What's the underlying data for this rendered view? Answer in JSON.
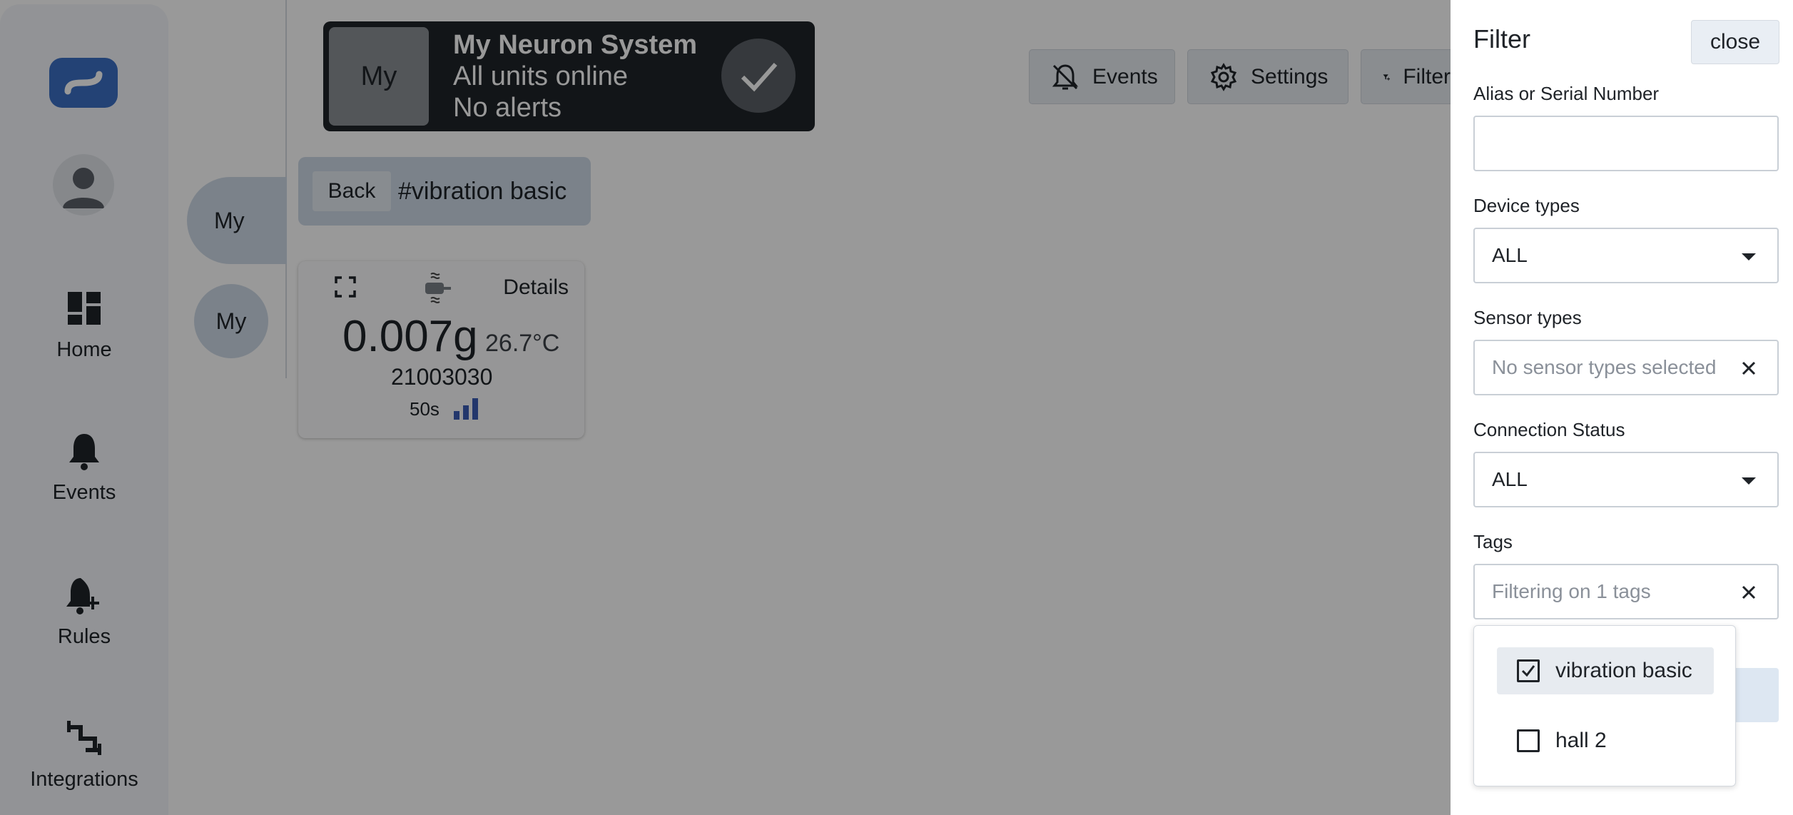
{
  "sidebar": {
    "items": [
      {
        "label": "Home",
        "icon": "dashboard-icon"
      },
      {
        "label": "Events",
        "icon": "bell-icon"
      },
      {
        "label": "Rules",
        "icon": "bell-plus-icon"
      },
      {
        "label": "Integrations",
        "icon": "integrations-icon"
      }
    ]
  },
  "system": {
    "thumb": "My",
    "title": "My Neuron System",
    "line1": "All units online",
    "line2": "No alerts"
  },
  "toolbar": {
    "events_label": "Events",
    "settings_label": "Settings",
    "filter_label": "Filter"
  },
  "groups": {
    "pill1": "My",
    "pill2": "My"
  },
  "breadcrumb": {
    "back_label": "Back",
    "tag": "#vibration basic"
  },
  "device": {
    "details_label": "Details",
    "value": "0.007g",
    "temperature": "26.7°C",
    "serial": "21003030",
    "age": "50s"
  },
  "filter": {
    "title": "Filter",
    "close_label": "close",
    "alias_label": "Alias or Serial Number",
    "alias_value": "",
    "device_types_label": "Device types",
    "device_types_value": "ALL",
    "sensor_types_label": "Sensor types",
    "sensor_types_placeholder": "No sensor types selected",
    "connection_label": "Connection Status",
    "connection_value": "ALL",
    "tags_label": "Tags",
    "tags_placeholder": "Filtering on 1 tags",
    "tag_options": [
      {
        "label": "vibration basic",
        "checked": true
      },
      {
        "label": "hall 2",
        "checked": false
      }
    ]
  },
  "colors": {
    "accent": "#3b6fc4",
    "dark_card": "#1f2328",
    "overlay": "rgba(0,0,0,0.4)"
  }
}
